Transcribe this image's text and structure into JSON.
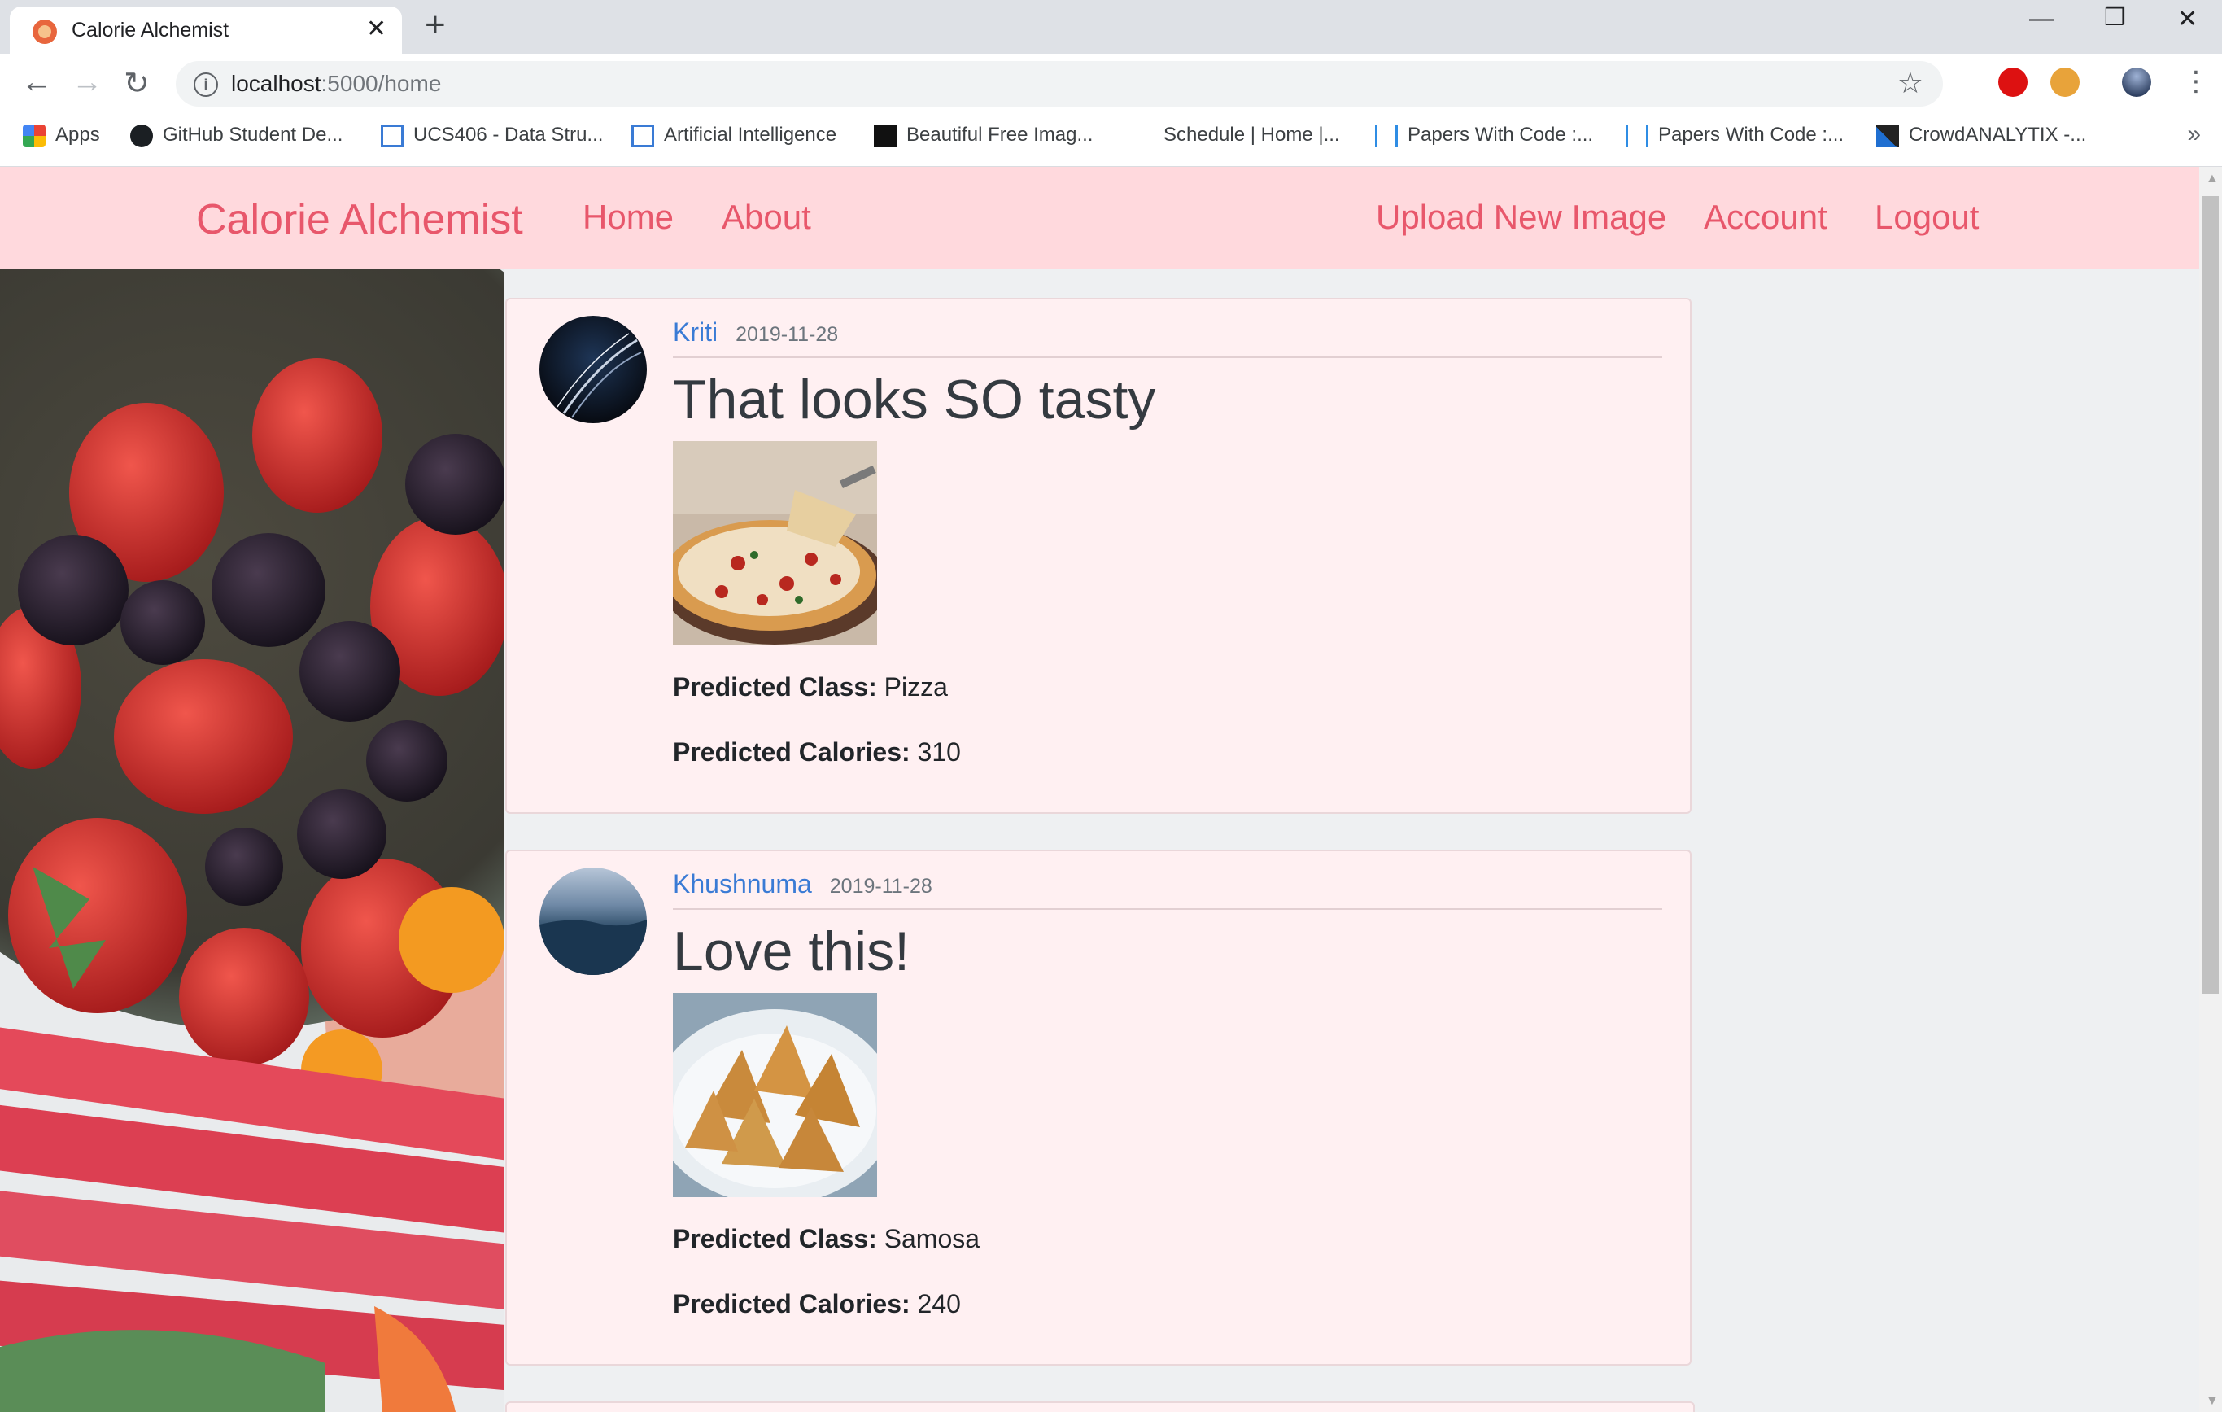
{
  "browser": {
    "tab_title": "Calorie Alchemist",
    "url_host": "localhost",
    "url_rest": ":5000/home",
    "bookmarks": [
      "Apps",
      "GitHub Student De...",
      "UCS406 - Data Stru...",
      "Artificial Intelligence",
      "Beautiful Free Imag...",
      "Schedule | Home |...",
      "Papers With Code :...",
      "Papers With Code :...",
      "CrowdANALYTIX -..."
    ],
    "more_bookmarks": "»"
  },
  "navbar": {
    "brand": "Calorie Alchemist",
    "left_links": [
      "Home",
      "About"
    ],
    "right_links": [
      "Upload New Image",
      "Account",
      "Logout"
    ]
  },
  "posts": [
    {
      "author": "Kriti",
      "date": "2019-11-28",
      "title": "That looks SO tasty",
      "class_label": "Predicted Class:",
      "class_value": "Pizza",
      "calories_label": "Predicted Calories:",
      "calories_value": "310"
    },
    {
      "author": "Khushnuma",
      "date": "2019-11-28",
      "title": "Love this!",
      "class_label": "Predicted Class:",
      "class_value": "Samosa",
      "calories_label": "Predicted Calories:",
      "calories_value": "240"
    }
  ],
  "colors": {
    "navbar_bg": "#ffd9dd",
    "brand": "#e8576b",
    "link": "#3a7bd5",
    "card_bg": "#fff0f2"
  }
}
